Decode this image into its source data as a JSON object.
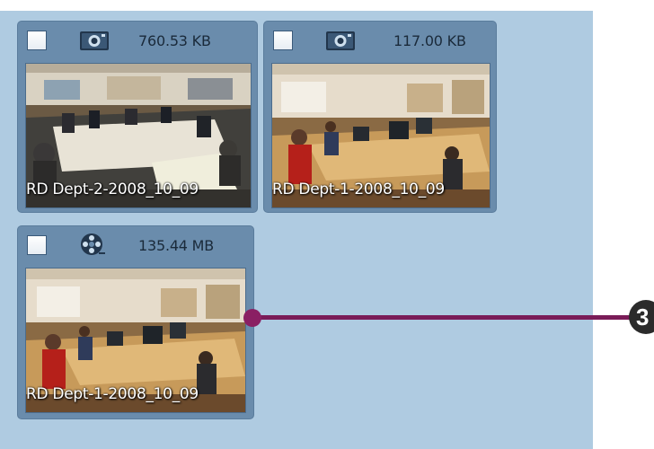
{
  "media_items": [
    {
      "type_icon": "camera-icon",
      "size": "760.53 KB",
      "caption": "RD Dept-2-2008_10_09"
    },
    {
      "type_icon": "camera-icon",
      "size": "117.00 KB",
      "caption": "RD Dept-1-2008_10_09"
    },
    {
      "type_icon": "film-reel-icon",
      "size": "135.44 MB",
      "caption": "RD Dept-1-2008_10_09"
    }
  ],
  "callout": {
    "number": "3"
  },
  "colors": {
    "panel_background": "#afcbe1",
    "card": "#6a8cac",
    "callout": "#7a1c58"
  }
}
